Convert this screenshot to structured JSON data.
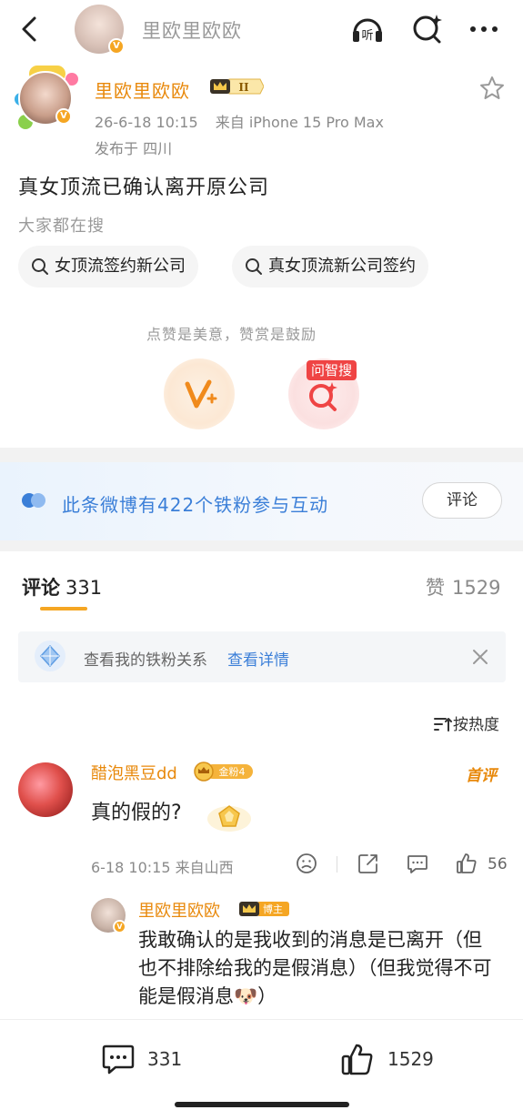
{
  "topbar": {
    "username": "里欧里欧欧",
    "avatar_badge": "V",
    "listen_label": "听",
    "icons": [
      "back-icon",
      "listen-icon",
      "ask-search-icon",
      "more-icon"
    ]
  },
  "post": {
    "author": "里欧里欧欧",
    "vip_level": "II",
    "timestamp": "26-6-18 10:15",
    "source": "来自 iPhone 15 Pro Max",
    "location": "发布于 四川",
    "content": "真女顶流已确认离开原公司",
    "search_label": "大家都在搜",
    "search_chips": [
      "女顶流签约新公司",
      "真女顶流新公司签约"
    ],
    "tip": "点赞是美意，赞赏是鼓励",
    "wzs_tag": "问智搜"
  },
  "fans_bar": {
    "text": "此条微博有422个铁粉参与互动",
    "button": "评论"
  },
  "tabs": {
    "comments_label": "评论",
    "comments_count": "331",
    "likes_label": "赞",
    "likes_count": "1529"
  },
  "ironfan": {
    "text": "查看我的铁粉关系",
    "link": "查看详情"
  },
  "sort_label": "按热度",
  "comment": {
    "author": "醋泡黑豆dd",
    "fan_badge": "金粉4",
    "top_label": "首评",
    "text": "真的假的?",
    "meta": "6-18 10:15 来自山西",
    "likes": "56",
    "reply": {
      "author": "里欧里欧欧",
      "role_badge": "博主",
      "text": "我敢确认的是我收到的消息是已离开（但也不排除给我的是假消息）（但我觉得不可能是假消息🐶）"
    }
  },
  "bottom": {
    "comments": "331",
    "likes": "1529"
  },
  "colors": {
    "accent_orange": "#e8890c",
    "link_blue": "#3b7fd8",
    "tag_red": "#ef4444"
  }
}
